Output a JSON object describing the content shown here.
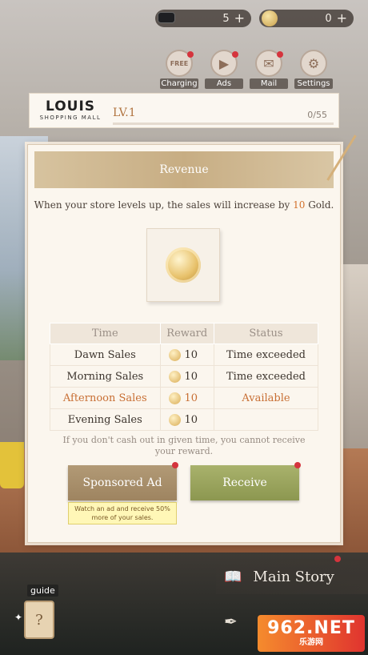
{
  "currency": {
    "tickets": "5",
    "gold": "0",
    "plus": "+"
  },
  "top_icons": [
    {
      "label": "Charging",
      "glyph": "FREE"
    },
    {
      "label": "Ads",
      "glyph": "▶"
    },
    {
      "label": "Mail",
      "glyph": "✉"
    },
    {
      "label": "Settings",
      "glyph": "⚙"
    }
  ],
  "store": {
    "brand": "LOUIS",
    "brand_sub": "SHOPPING MALL",
    "level": "LV.1",
    "progress_text": "0/55",
    "progress": 0
  },
  "revenue_tag": "Revenue",
  "panel": {
    "title": "Revenue",
    "desc_prefix": "When your store levels up, the sales will increase by ",
    "desc_amount": "10",
    "desc_suffix": " Gold.",
    "columns": [
      "Time",
      "Reward",
      "Status"
    ],
    "rows": [
      {
        "time": "Dawn Sales",
        "reward": "10",
        "status": "Time exceeded"
      },
      {
        "time": "Morning Sales",
        "reward": "10",
        "status": "Time exceeded"
      },
      {
        "time": "Afternoon Sales",
        "reward": "10",
        "status": "Available"
      },
      {
        "time": "Evening Sales",
        "reward": "10",
        "status": ""
      }
    ],
    "warning": "If you don't cash out in given time, you cannot receive your reward.",
    "ad_button": "Sponsored Ad",
    "receive_button": "Receive",
    "tip": "Watch an ad and receive 50% more of your sales."
  },
  "bottom": {
    "main_story": "Main Story",
    "guide": "guide"
  },
  "watermark": {
    "name": "962.NET",
    "sub": "乐游网"
  },
  "colors": {
    "accent": "#d3712c",
    "red_dot": "#d5343d",
    "receive": "#9aa55c",
    "ad": "#a88f6b"
  }
}
